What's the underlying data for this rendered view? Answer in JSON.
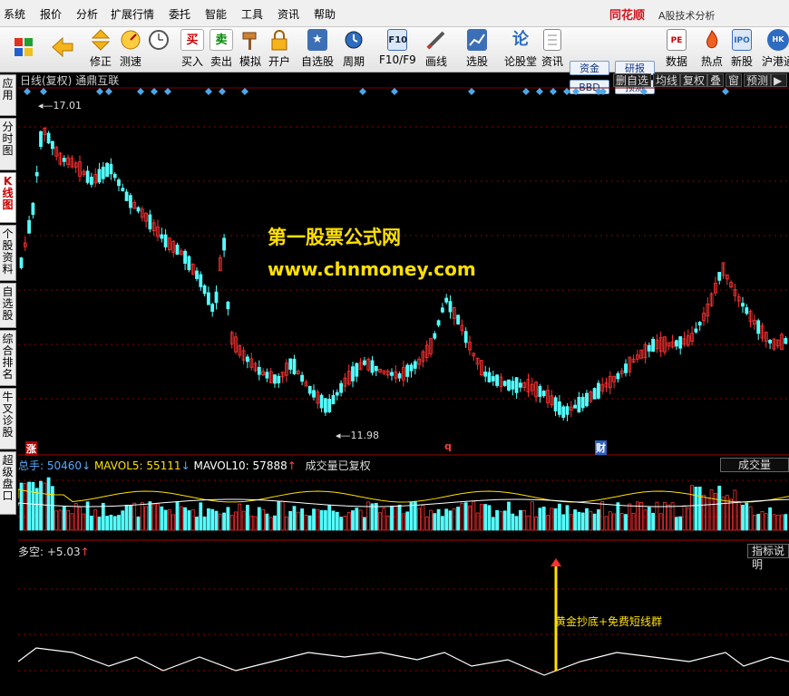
{
  "menu": [
    "系统",
    "报价",
    "分析",
    "扩展行情",
    "委托",
    "智能",
    "工具",
    "资讯",
    "帮助"
  ],
  "brand": {
    "name": "同花顺",
    "subtitle": "A股技术分析"
  },
  "toolbar": {
    "buttons": [
      {
        "label": "",
        "icon": "windows-grid-icon"
      },
      {
        "label": "",
        "icon": "back-arrow-icon"
      },
      {
        "label": "修正",
        "icon": "updown-arrows-icon"
      },
      {
        "label": "测速",
        "icon": "speed-icon"
      },
      {
        "label": "",
        "icon": "clock-icon"
      },
      {
        "label": "买入",
        "icon": "buy-icon"
      },
      {
        "label": "卖出",
        "icon": "sell-icon"
      },
      {
        "label": "模拟",
        "icon": "hammer-icon"
      },
      {
        "label": "开户",
        "icon": "lock-icon"
      },
      {
        "label": "自选股",
        "icon": "star-icon"
      },
      {
        "label": "周期",
        "icon": "period-icon"
      },
      {
        "label": "F10/F9",
        "icon": "f10-icon"
      },
      {
        "label": "画线",
        "icon": "pen-icon"
      },
      {
        "label": "选股",
        "icon": "select-icon"
      },
      {
        "label": "论股堂",
        "icon": "forum-icon"
      },
      {
        "label": "资讯",
        "icon": "news-icon"
      },
      {
        "label": "数据",
        "icon": "data-icon"
      },
      {
        "label": "热点",
        "icon": "fire-icon"
      },
      {
        "label": "新股",
        "icon": "ipo-icon"
      },
      {
        "label": "沪港通",
        "icon": "hk-icon"
      }
    ],
    "small": [
      "资金",
      "BBD",
      "研报",
      "预测"
    ]
  },
  "left_tabs": [
    "应用",
    "分时图",
    "K线图",
    "个股资料",
    "自选股",
    "综合排名",
    "牛叉诊股",
    "超级盘口"
  ],
  "chart": {
    "title": "日线(复权)",
    "stock": "通鼎互联",
    "right_buttons": [
      "删自选",
      "均线",
      "复权",
      "叠",
      "窗",
      "预测"
    ],
    "high_label": "17.01",
    "low_label": "11.98",
    "markers": {
      "zhang": "涨",
      "q": "q",
      "cai": "财"
    },
    "watermark_line1": "第一股票公式网",
    "watermark_line2": "www.chnmoney.com"
  },
  "volume": {
    "total_label": "总手:",
    "total_value": "50460",
    "mavol5_label": "MAVOL5:",
    "mavol5_value": "55111",
    "mavol10_label": "MAVOL10:",
    "mavol10_value": "57888",
    "note": "成交量已复权",
    "right_box": "成交量"
  },
  "indicator": {
    "name": "多空:",
    "value": "+5.03",
    "right_box": "指标说明",
    "annotation": "黄金抄底+免费短线群"
  },
  "colors": {
    "up": "#ff3232",
    "down": "#54ffff",
    "yellow": "#ffe000",
    "white": "#ffffff",
    "grid": "#8b0000",
    "text": "#cfcfcf"
  }
}
